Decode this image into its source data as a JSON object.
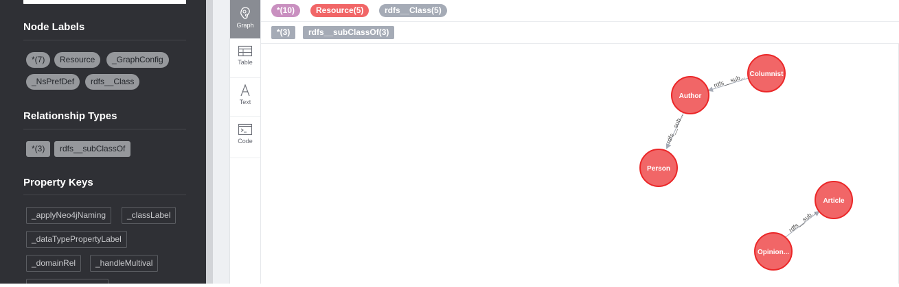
{
  "sidebar": {
    "node_labels_title": "Node Labels",
    "node_labels": [
      "*(7)",
      "Resource",
      "_GraphConfig",
      "_NsPrefDef",
      "rdfs__Class"
    ],
    "relationship_types_title": "Relationship Types",
    "relationship_types": [
      "*(3)",
      "rdfs__subClassOf"
    ],
    "property_keys_title": "Property Keys",
    "property_keys": [
      "_applyNeo4jNaming",
      "_classLabel",
      "_dataTypePropertyLabel",
      "_domainRel",
      "_handleMultival"
    ]
  },
  "view_tabs": [
    {
      "label": "Graph",
      "icon": "graph-icon",
      "active": true
    },
    {
      "label": "Table",
      "icon": "table-icon",
      "active": false
    },
    {
      "label": "Text",
      "icon": "text-icon",
      "active": false
    },
    {
      "label": "Code",
      "icon": "code-icon",
      "active": false
    }
  ],
  "result_bar": {
    "node_tags": [
      {
        "label": "*(10)",
        "color": "#c990c0"
      },
      {
        "label": "Resource(5)",
        "color": "#f16667"
      },
      {
        "label": "rdfs__Class(5)",
        "color": "#a5abb6"
      }
    ],
    "rel_tags": [
      {
        "label": "*(3)",
        "color": "#a5abb6"
      },
      {
        "label": "rdfs__subClassOf(3)",
        "color": "#a5abb6"
      }
    ]
  },
  "graph": {
    "node_color": "#f16667",
    "node_stroke": "#eb2728",
    "nodes": {
      "columnist": "Columnist",
      "author": "Author",
      "person": "Person",
      "article": "Article",
      "opinion": "Opinion..."
    },
    "edge_label": "rdfs__sub..."
  }
}
